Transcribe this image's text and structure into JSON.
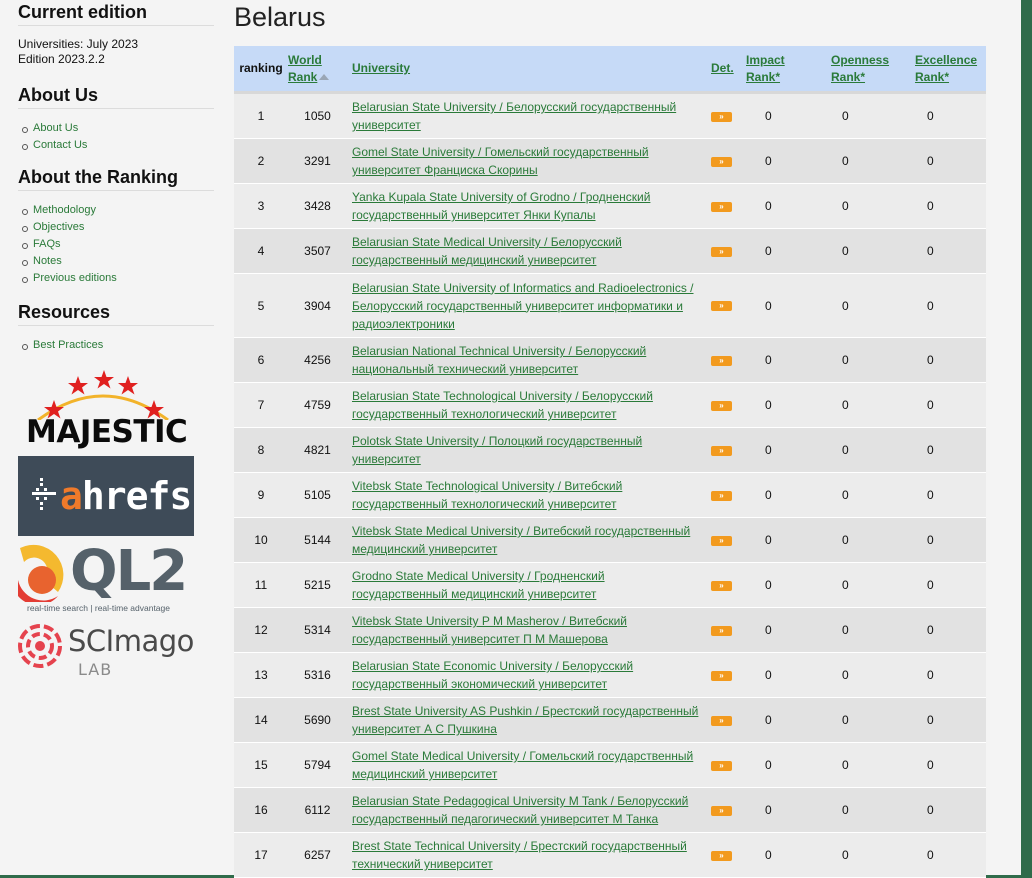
{
  "sidebar": {
    "current_edition": {
      "heading": "Current edition",
      "line1": "Universities: July 2023",
      "line2": "Edition 2023.2.2"
    },
    "about_us": {
      "heading": "About Us",
      "items": [
        "About Us",
        "Contact Us"
      ]
    },
    "about_ranking": {
      "heading": "About the Ranking",
      "items": [
        "Methodology",
        "Objectives",
        "FAQs",
        "Notes",
        "Previous editions"
      ]
    },
    "resources": {
      "heading": "Resources",
      "items": [
        "Best Practices"
      ]
    },
    "logos": {
      "majestic": "MAJESTIC",
      "ahrefs_a": "a",
      "ahrefs_rest": "hrefs",
      "ql2": "QL2",
      "ql2_tagline": "real-time search | real-time advantage",
      "scimago": "SCImago",
      "scimago_lab": "LAB"
    }
  },
  "main": {
    "title": "Belarus",
    "columns": {
      "ranking": "ranking",
      "world_rank_1": "World",
      "world_rank_2": "Rank",
      "university": "University",
      "det": "Det.",
      "impact_1": "Impact",
      "impact_2": "Rank*",
      "openness_1": "Openness",
      "openness_2": "Rank*",
      "excellence_1": "Excellence",
      "excellence_2": "Rank*"
    },
    "det_glyph": "»",
    "rows": [
      {
        "ranking": "1",
        "world_rank": "1050",
        "university": "Belarusian State University / Белорусский государственный университет",
        "impact": "0",
        "openness": "0",
        "excellence": "0"
      },
      {
        "ranking": "2",
        "world_rank": "3291",
        "university": "Gomel State University / Гомельский государственный университет Франциска Скорины",
        "impact": "0",
        "openness": "0",
        "excellence": "0"
      },
      {
        "ranking": "3",
        "world_rank": "3428",
        "university": "Yanka Kupala State University of Grodno / Гродненский государственный университет Янки Купалы",
        "impact": "0",
        "openness": "0",
        "excellence": "0"
      },
      {
        "ranking": "4",
        "world_rank": "3507",
        "university": "Belarusian State Medical University / Белорусский государственный медицинский университет",
        "impact": "0",
        "openness": "0",
        "excellence": "0"
      },
      {
        "ranking": "5",
        "world_rank": "3904",
        "university": "Belarusian State University of Informatics and Radioelectronics / Белорусский государственный университет информатики и радиоэлектроники",
        "impact": "0",
        "openness": "0",
        "excellence": "0"
      },
      {
        "ranking": "6",
        "world_rank": "4256",
        "university": "Belarusian National Technical University / Белорусский национальный технический университет",
        "impact": "0",
        "openness": "0",
        "excellence": "0"
      },
      {
        "ranking": "7",
        "world_rank": "4759",
        "university": "Belarusian State Technological University / Белорусский государственный технологический университет",
        "impact": "0",
        "openness": "0",
        "excellence": "0"
      },
      {
        "ranking": "8",
        "world_rank": "4821",
        "university": "Polotsk State University / Полоцкий государственный университет",
        "impact": "0",
        "openness": "0",
        "excellence": "0"
      },
      {
        "ranking": "9",
        "world_rank": "5105",
        "university": "Vitebsk State Technological University / Витебский государственный технологический университет",
        "impact": "0",
        "openness": "0",
        "excellence": "0"
      },
      {
        "ranking": "10",
        "world_rank": "5144",
        "university": "Vitebsk State Medical University / Витебский государственный медицинский университет",
        "impact": "0",
        "openness": "0",
        "excellence": "0"
      },
      {
        "ranking": "11",
        "world_rank": "5215",
        "university": "Grodno State Medical University / Гродненский государственный медицинский университет",
        "impact": "0",
        "openness": "0",
        "excellence": "0"
      },
      {
        "ranking": "12",
        "world_rank": "5314",
        "university": "Vitebsk State University P M Masherov / Витебский государственный университет П М Машерова",
        "impact": "0",
        "openness": "0",
        "excellence": "0"
      },
      {
        "ranking": "13",
        "world_rank": "5316",
        "university": "Belarusian State Economic University / Белорусский государственный экономический университет",
        "impact": "0",
        "openness": "0",
        "excellence": "0"
      },
      {
        "ranking": "14",
        "world_rank": "5690",
        "university": "Brest State University AS Pushkin / Брестский государственный университет А С Пушкина",
        "impact": "0",
        "openness": "0",
        "excellence": "0"
      },
      {
        "ranking": "15",
        "world_rank": "5794",
        "university": "Gomel State Medical University / Гомельский государственный медицинский университет",
        "impact": "0",
        "openness": "0",
        "excellence": "0"
      },
      {
        "ranking": "16",
        "world_rank": "6112",
        "university": "Belarusian State Pedagogical University M Tank / Белорусский государственный педагогический университет М Танка",
        "impact": "0",
        "openness": "0",
        "excellence": "0"
      },
      {
        "ranking": "17",
        "world_rank": "6257",
        "university": "Brest State Technical University / Брестский государственный технический университет",
        "impact": "0",
        "openness": "0",
        "excellence": "0"
      }
    ]
  }
}
